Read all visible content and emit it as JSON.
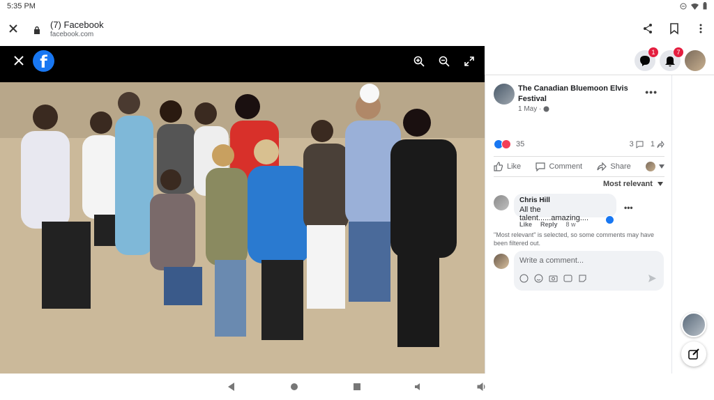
{
  "status_bar": {
    "time": "5:35 PM"
  },
  "browser": {
    "title": "(7) Facebook",
    "url": "facebook.com"
  },
  "viewer": {
    "logo_letter": "f"
  },
  "top_nav": {
    "messenger_badge": "1",
    "notifications_badge": "7"
  },
  "post": {
    "page_name": "The Canadian Bluemoon Elvis Festival",
    "date": "1 May ·",
    "more": "•••",
    "reaction_count": "35",
    "comment_count": "3",
    "share_count": "1",
    "actions": {
      "like": "Like",
      "comment": "Comment",
      "share": "Share"
    },
    "sort_label": "Most relevant"
  },
  "comments": [
    {
      "author": "Chris Hill",
      "text": "All the talent......amazing....",
      "like": "Like",
      "reply": "Reply",
      "age": "8 w"
    }
  ],
  "filter_note": "\"Most relevant\" is selected, so some comments may have been filtered out.",
  "composer": {
    "placeholder": "Write a comment..."
  },
  "colors": {
    "facebook_blue": "#1877f2",
    "badge_red": "#e41e3f"
  }
}
